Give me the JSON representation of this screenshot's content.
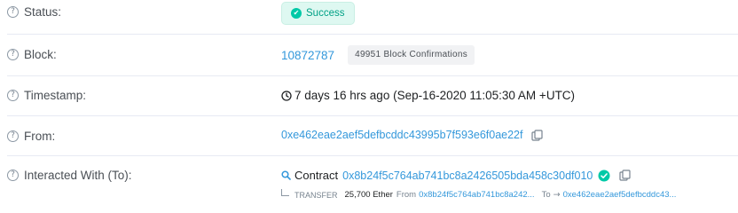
{
  "rows": {
    "status": {
      "label": "Status:",
      "value": "Success"
    },
    "block": {
      "label": "Block:",
      "number": "10872787",
      "confirmations": "49951 Block Confirmations"
    },
    "timestamp": {
      "label": "Timestamp:",
      "value": "7 days 16 hrs ago (Sep-16-2020 11:05:30 AM +UTC)"
    },
    "from": {
      "label": "From:",
      "address": "0xe462eae2aef5defbcddc43995b7f593e6f0ae22f"
    },
    "to": {
      "label": "Interacted With (To):",
      "prefix": "Contract",
      "address": "0x8b24f5c764ab741bc8a2426505bda458c30df010",
      "transfer": {
        "keyword": "TRANSFER",
        "amount": "25,700 Ether",
        "from_label": "From",
        "from_address": "0x8b24f5c764ab741bc8a242...",
        "to_label": "To",
        "to_arrow": "→",
        "to_address": "0xe462eae2aef5defbcddc43..."
      }
    }
  },
  "help_icon_glyph": "?",
  "colors": {
    "link": "#3498db",
    "success_bg": "#def8f1",
    "success_text": "#00a186",
    "divider": "#e7eaf3"
  },
  "icons": [
    "help-icon",
    "success-check-icon",
    "clock-icon",
    "copy-icon",
    "contract-search-icon",
    "verified-check-icon"
  ]
}
